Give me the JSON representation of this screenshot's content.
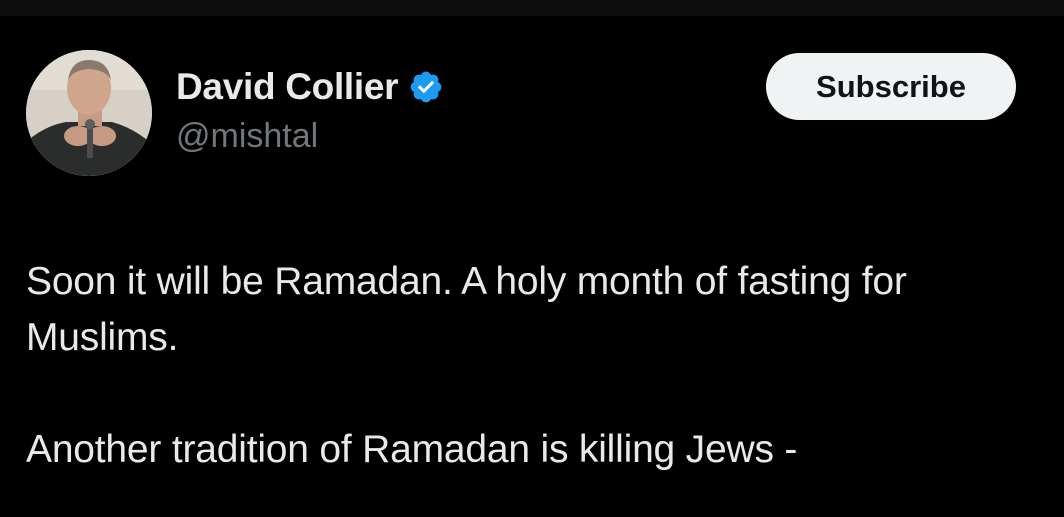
{
  "author": {
    "display_name": "David Collier",
    "handle": "@mishtal",
    "verified_icon": "verified-badge-icon",
    "avatar_icon": "avatar-photo"
  },
  "actions": {
    "subscribe_label": "Subscribe"
  },
  "tweet": {
    "paragraphs": [
      "Soon it will be Ramadan. A holy month of fasting for Muslims.",
      "Another tradition of Ramadan is killing Jews -"
    ]
  },
  "colors": {
    "background": "#000000",
    "text_primary": "#e7e9ea",
    "text_secondary": "#71767b",
    "verified_blue": "#1d9bf0",
    "button_bg": "#eff3f4",
    "button_text": "#0f1419"
  }
}
